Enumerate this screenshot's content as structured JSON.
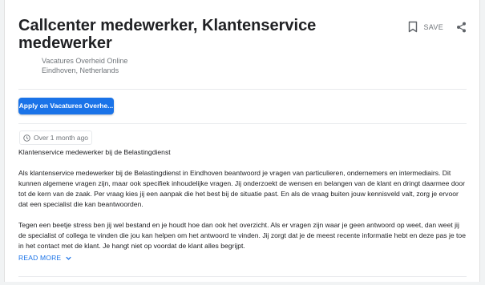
{
  "job": {
    "title": "Callcenter medewerker, Klantenservice medewerker",
    "company": "Vacatures Overheid Online",
    "location": "Eindhoven, Netherlands"
  },
  "actions": {
    "save_label": "SAVE",
    "save_icon": "bookmark-icon",
    "share_icon": "share-icon"
  },
  "apply": {
    "label": "Apply on Vacatures Overhe..."
  },
  "posted": {
    "icon": "clock-icon",
    "text": "Over 1 month ago"
  },
  "description": {
    "paragraphs": [
      "Klantenservice medewerker bij de Belastingdienst",
      "Als klantenservice medewerker bij de Belastingdienst in Eindhoven beantwoord je vragen van particulieren, ondernemers en intermediairs. Dit kunnen algemene vragen zijn, maar ook specifiek inhoudelijke vragen. Jij onderzoekt de wensen en belangen van de klant en dringt daarmee door tot de kern van de zaak. Per vraag kies jij een aanpak die het best bij de situatie past. En als de vraag buiten jouw kennisveld valt, zorg je ervoor dat een specialist die kan beantwoorden.",
      "Tegen een beetje stress ben jij wel bestand en je houdt hoe dan ook het overzicht. Als er vragen zijn waar je geen antwoord op weet, dan weet jij de specialist of collega te vinden die jou kan helpen om het antwoord te vinden. Jij zorgt dat je de meest recente informatie hebt en deze pas je toe in het contact met de klant. Je hangt niet op voordat de klant alles begrijpt."
    ],
    "read_more_label": "READ MORE",
    "read_more_icon": "chevron-down-icon"
  },
  "colors": {
    "accent": "#1a73e8",
    "muted_text": "#70757a"
  }
}
